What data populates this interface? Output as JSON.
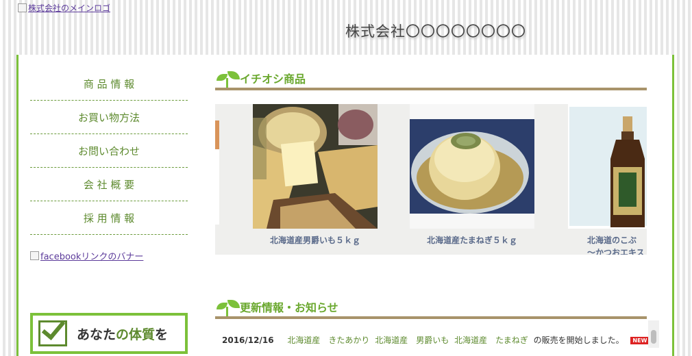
{
  "header": {
    "logo_alt": "株式会社のメインロゴ",
    "site_title": "株式会社〇〇〇〇〇〇〇〇"
  },
  "nav": {
    "items": [
      {
        "label": "商 品 情 報"
      },
      {
        "label": "お買い物方法"
      },
      {
        "label": "お問い合わせ"
      },
      {
        "label": "会 社 概 要"
      },
      {
        "label": "採 用 情 報"
      }
    ]
  },
  "sidebar": {
    "facebook_banner_alt": "facebookリンクのバナー",
    "taishitsu_text_a": "あなた",
    "taishitsu_text_b": "の体質",
    "taishitsu_text_c": "を"
  },
  "featured": {
    "title": "イチオシ商品",
    "products": [
      {
        "caption": "北海道産男爵いも５ｋｇ"
      },
      {
        "caption": "北海道産たまねぎ５ｋｇ"
      },
      {
        "caption": "北海道のこぶ"
      },
      {
        "caption_line2": "～かつおエキス"
      }
    ]
  },
  "news": {
    "title": "更新情報・お知らせ",
    "items": [
      {
        "date": "2016/12/16",
        "link1": "北海道産　きたあかり",
        "link2": "北海道産　男爵いも",
        "link3": "北海道産　たまねぎ",
        "text": "の販売を開始しました。",
        "badge": "NEW"
      }
    ]
  },
  "colors": {
    "accent_green": "#7cc13a",
    "nav_text": "#5d8a2e",
    "divider_brown": "#a8936a"
  }
}
